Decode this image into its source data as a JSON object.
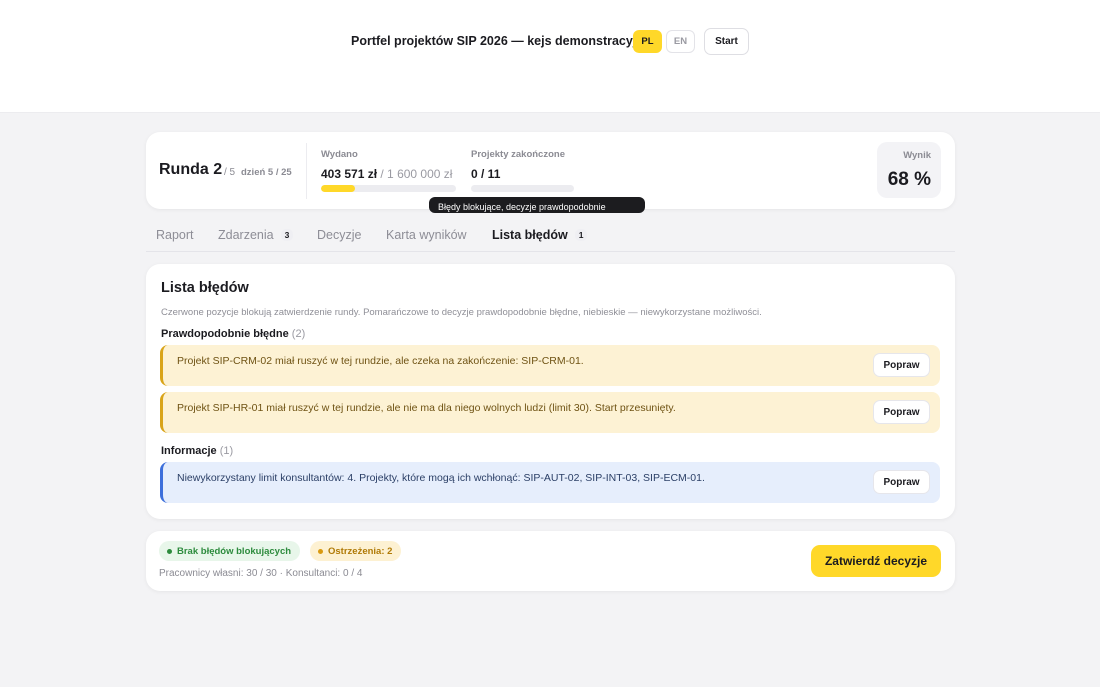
{
  "header": {
    "title": "Portfel projektów SIP 2026 — kejs demonstracyjny",
    "lang_pl": "PL",
    "lang_en": "EN",
    "start_label": "Start"
  },
  "status": {
    "round_label": "Runda 2",
    "round_of": "/ 5",
    "day": "dzień 5 / 25",
    "spent_label": "Wydano",
    "spent_value": "403 571 zł",
    "spent_total": "/ 1 600 000 zł",
    "spent_fraction": 0.252,
    "projects_label": "Projekty zakończone",
    "projects_value": "0 / 11",
    "projects_fraction": 0.0,
    "score_label": "Wynik",
    "score_value": "68 %"
  },
  "tooltip": "Błędy blokujące, decyzje prawdopodobnie",
  "tabs": [
    {
      "label": "Raport",
      "count": ""
    },
    {
      "label": "Zdarzenia",
      "count": "3"
    },
    {
      "label": "Decyzje",
      "count": ""
    },
    {
      "label": "Karta wyników",
      "count": ""
    },
    {
      "label": "Lista błędów",
      "count": "1"
    }
  ],
  "errors": {
    "title": "Lista błędów",
    "description": "Czerwone pozycje blokują zatwierdzenie rundy. Pomarańczowe to decyzje prawdopodobnie błędne, niebieskie — niewykorzystane możliwości.",
    "likely_title": "Prawdopodobnie błędne",
    "likely_count": "(2)",
    "likely_items": [
      "Projekt SIP-CRM-02 miał ruszyć w tej rundzie, ale czeka na zakończenie: SIP-CRM-01.",
      "Projekt SIP-HR-01 miał ruszyć w tej rundzie, ale nie ma dla niego wolnych ludzi (limit 30). Start przesunięty."
    ],
    "info_title": "Informacje",
    "info_count": "(1)",
    "info_items": [
      "Niewykorzystany limit konsultantów: 4. Projekty, które mogą ich wchłonąć: SIP-AUT-02, SIP-INT-03, SIP-ECM-01."
    ],
    "fix_label": "Popraw"
  },
  "footer": {
    "ok_badge": "Brak błędów blokujących",
    "warn_badge": "Ostrzeżenia: 2",
    "workers": "Pracownicy własni: 30 / 30 · Konsultanci: 0 / 4",
    "confirm_label": "Zatwierdź decyzje"
  }
}
